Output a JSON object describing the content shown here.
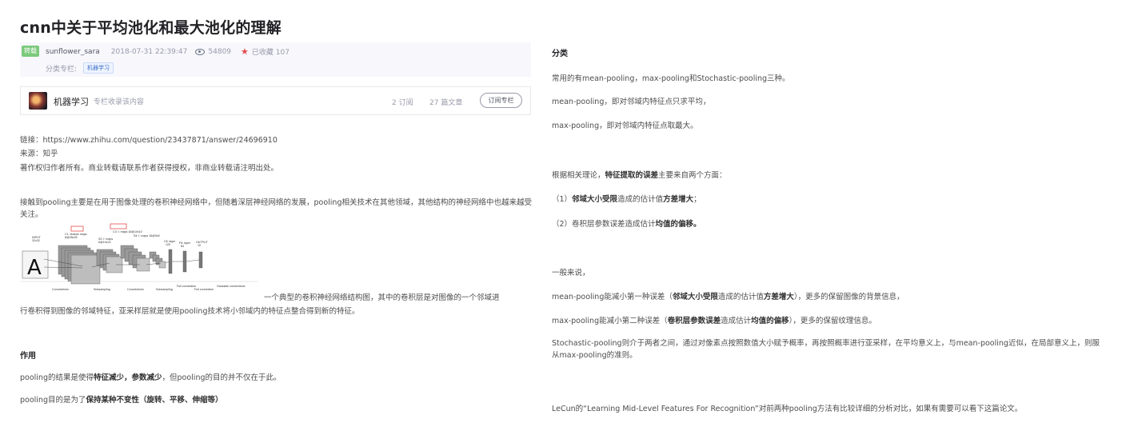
{
  "article": {
    "title": "cnn中关于平均池化和最大池化的理解",
    "badge": "转载",
    "author": "sunflower_sara",
    "datetime": "2018-07-31 22:39:47",
    "views": "54809",
    "favorites": "已收藏 107",
    "category_label": "分类专栏:",
    "category_tag": "机器学习"
  },
  "column": {
    "name": "机器学习",
    "desc": "专栏收录该内容",
    "subs": "2 订阅",
    "posts": "27 篇文章",
    "subscribe": "订阅专栏"
  },
  "left": {
    "link": "链接：https://www.zhihu.com/question/23437871/answer/24696910",
    "source": "来源：知乎",
    "copyright": "著作权归作者所有。商业转载请联系作者获得授权，非商业转载请注明出处。",
    "intro": "接触到pooling主要是在用于图像处理的卷积神经网络中，但随着深层神经网络的发展，pooling相关技术在其他领域，其他结构的神经网络中也越来越受关注。",
    "fig_caption_1": "一个典型的卷积神经网络结构图，其中的卷积层是对图像的一个邻域进",
    "fig_caption_2": "行卷积得到图像的邻域特征，亚采样层就是使用pooling技术将小邻域内的特征点整合得到新的特征。",
    "sec_title": "作用",
    "p1_a": "pooling的结果是使得",
    "p1_b": "特征减少，参数减少",
    "p1_c": "，但pooling的目的并不仅在于此。",
    "p2_a": "pooling目的是为了",
    "p2_b": "保持某种不变性（旋转、平移、伸缩等）"
  },
  "diagram": {
    "input": "INPUT",
    "input_size": "32x32",
    "c1": "C1: feature maps",
    "c1_size": "6@28x28",
    "s2": "S2: f. maps",
    "s2_size": "6@14x14",
    "c3": "C3: f. maps 16@10x10",
    "s4": "S4: f. maps 16@5x5",
    "c5": "C5: layer",
    "c5_n": "120",
    "f6": "F6: layer",
    "f6_n": "84",
    "output": "OUTPUT",
    "output_n": "10",
    "l_conv1": "Convolutions",
    "l_sub1": "Subsampling",
    "l_conv2": "Convolutions",
    "l_sub2": "Subsampling",
    "l_full1": "Full connection",
    "l_full2": "Full connection",
    "l_gauss": "Gaussian connections",
    "glyph": "A",
    "accent": "#e34d4d"
  },
  "right": {
    "sec_title": "分类",
    "r1": "常用的有mean-pooling，max-pooling和Stochastic-pooling三种。",
    "r2": "mean-pooling，即对邻域内特征点只求平均，",
    "r3": "max-pooling，即对邻域内特征点取最大。",
    "r4_a": "根据相关理论，",
    "r4_b": "特征提取的误差",
    "r4_c": "主要来自两个方面：",
    "r5_a": "（1）",
    "r5_b": "邻域大小受限",
    "r5_c": "造成的估计值",
    "r5_d": "方差增大",
    "r5_e": "；",
    "r6_a": "（2）卷积层参数误差造成估计",
    "r6_b": "均值的偏移。",
    "r7": "一般来说，",
    "r8_a": "mean-pooling能减小第一种误差（",
    "r8_b": "邻域大小受限",
    "r8_c": "造成的估计值",
    "r8_d": "方差增大",
    "r8_e": "），更多的保留图像的背景信息，",
    "r9_a": "max-pooling能减小第二种误差（",
    "r9_b": "卷积层参数误差",
    "r9_c": "造成估计",
    "r9_d": "均值的偏移",
    "r9_e": "），更多的保留纹理信息。",
    "r10": "Stochastic-pooling则介于两者之间，通过对像素点按照数值大小赋予概率，再按照概率进行亚采样，在平均意义上，与mean-pooling近似，在局部意义上，则服从max-pooling的准则。",
    "r11": "LeCun的“Learning Mid-Level Features For Recognition”对前两种pooling方法有比较详细的分析对比，如果有需要可以看下这篇论文。"
  }
}
